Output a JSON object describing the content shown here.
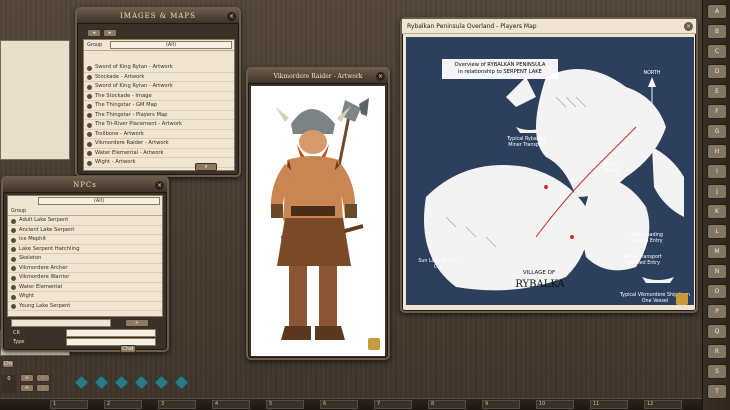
{
  "images_window": {
    "title": "IMAGES & MAPS",
    "group_label": "Group",
    "group_value": "(All)",
    "items": [
      "Sword of King Rytan - Artwork",
      "Stockade - Artwork",
      "Sword of King Rytan - Artwork",
      "The Stockade - Image",
      "The Thingstar - GM Map",
      "The Thingstar - Players Map",
      "The Tri-River Placement - Artwork",
      "Trollbone - Artwork",
      "Vikmordere Raider - Artwork",
      "Water Elemental - Artwork",
      "Wight - Artwork"
    ]
  },
  "npc_window": {
    "title": "NPCs",
    "filter_value": "(All)",
    "group_label": "Group",
    "items": [
      "Adult Lake Serpent",
      "Ancient Lake Serpent",
      "Ice Mephit",
      "Lake Serpent Hatchling",
      "Skeleton",
      "Vikmordere Archer",
      "Vikmordere Warrior",
      "Water Elemental",
      "Wight",
      "Young Lake Serpent"
    ],
    "type_label": "Type",
    "cr_label": "CR",
    "chat_label": "Chat"
  },
  "artwork_window": {
    "title": "Vikmordere Raider - Artwork"
  },
  "map_window": {
    "title": "Rybalkan Peninsula Overland - Players Map",
    "callout_line1": "Overview of RYBALKAN PENINSULA",
    "callout_line2": "in relationship to SERPENT LAKE",
    "north_label": "NORTH",
    "labels": {
      "miner_transport_1": "Typical Rybalkan Miner Transport",
      "burial_mound": "Burial Mound",
      "mine_loading": "Mine Loading Cavern Entry",
      "miner_transport_2": "Miner Transport Fortified Entry",
      "sun_lord": "Sun Lord Tooth's Cry",
      "village_of": "VILLAGE OF",
      "rybalka": "RYBALKA",
      "vikmordere_ship": "Typical Vikmordere Ship from One Vessel"
    }
  },
  "rail_buttons": [
    "A",
    "B",
    "C",
    "D",
    "E",
    "F",
    "G",
    "H",
    "I",
    "J",
    "K",
    "L",
    "M",
    "N",
    "O",
    "P",
    "Q",
    "R",
    "S",
    "T"
  ],
  "dice": [
    "d4",
    "d6",
    "d8",
    "d10",
    "d12",
    "d20"
  ],
  "hotkeys": [
    "1",
    "2",
    "3",
    "4",
    "5",
    "6",
    "7",
    "8",
    "9",
    "10",
    "11",
    "12"
  ],
  "colors": {
    "desktop": "#4a4036",
    "parchment": "#efe5d2",
    "map_water": "#2c3f5c",
    "dice": "#2d7a80"
  }
}
